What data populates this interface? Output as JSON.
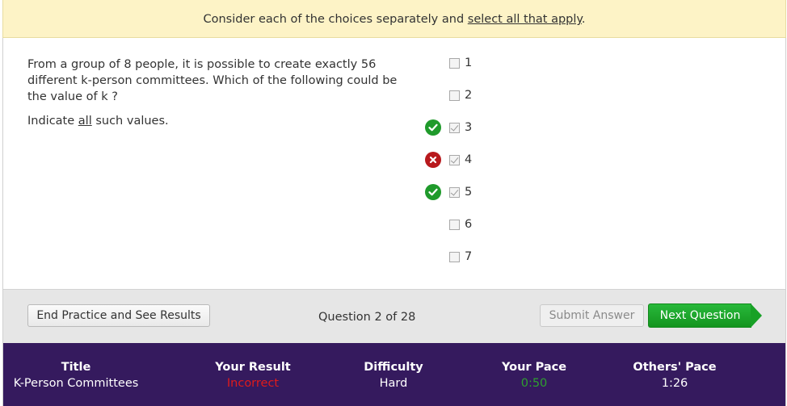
{
  "banner": {
    "text_before": "Consider each of the choices separately and ",
    "link_text": "select all that apply",
    "text_after": "."
  },
  "question": {
    "text": "From a group of 8 people, it is possible to create exactly 56 different k-person committees. Which of the following could be the value of k ?",
    "indicate_before": "Indicate ",
    "indicate_underlined": "all",
    "indicate_after": " such values."
  },
  "choices": [
    {
      "label": "1",
      "checked": false,
      "result": ""
    },
    {
      "label": "2",
      "checked": false,
      "result": ""
    },
    {
      "label": "3",
      "checked": true,
      "result": "correct"
    },
    {
      "label": "4",
      "checked": true,
      "result": "incorrect"
    },
    {
      "label": "5",
      "checked": true,
      "result": "correct"
    },
    {
      "label": "6",
      "checked": false,
      "result": ""
    },
    {
      "label": "7",
      "checked": false,
      "result": ""
    }
  ],
  "toolbar": {
    "end_label": "End Practice and See Results",
    "question_counter": "Question 2 of 28",
    "submit_label": "Submit Answer",
    "next_label": "Next Question"
  },
  "footer": {
    "title_header": "Title",
    "title_value": "K-Person Committees",
    "result_header": "Your Result",
    "result_value": "Incorrect",
    "difficulty_header": "Difficulty",
    "difficulty_value": "Hard",
    "pace_header": "Your Pace",
    "pace_value": "0:50",
    "others_header": "Others' Pace",
    "others_value": "1:26"
  },
  "colors": {
    "banner_bg": "#fdf3c6",
    "correct": "#1f9a2b",
    "incorrect": "#b8191d",
    "next_button": "#18a126",
    "footer_bg": "#351a5e"
  },
  "icons": {
    "correct": "check-circle-icon",
    "incorrect": "x-circle-icon"
  }
}
